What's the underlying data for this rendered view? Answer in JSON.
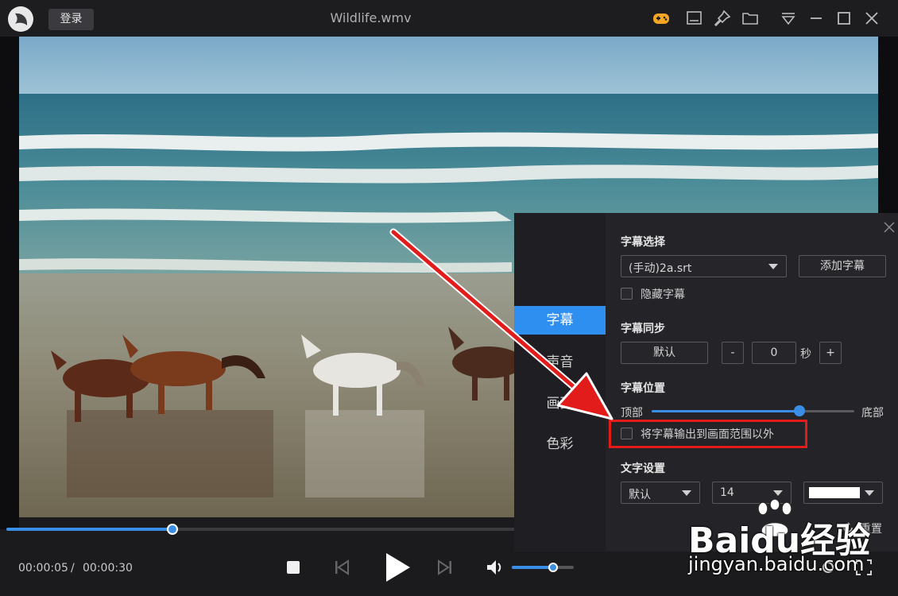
{
  "titlebar": {
    "login_label": "登录",
    "title": "Wildlife.wmv",
    "icons": [
      "game-controller-icon",
      "screenshot-icon",
      "pin-icon",
      "folder-icon",
      "menu-icon",
      "minimize-icon",
      "maximize-icon",
      "close-icon"
    ]
  },
  "player": {
    "progress": 0.188,
    "time_current": "00:00:05",
    "time_separator": "/",
    "time_total": "00:00:30",
    "volume": 0.67
  },
  "panel": {
    "nav": [
      {
        "label": "字幕",
        "active": true
      },
      {
        "label": "声音",
        "active": false
      },
      {
        "label": "画面",
        "active": false
      },
      {
        "label": "色彩",
        "active": false
      }
    ],
    "subtitle_select": {
      "title": "字幕选择",
      "selected": "(手动)2a.srt",
      "add_button": "添加字幕",
      "hide_label": "隐藏字幕"
    },
    "subtitle_sync": {
      "title": "字幕同步",
      "default_button": "默认",
      "minus": "-",
      "value": "0",
      "unit": "秒",
      "plus": "+"
    },
    "subtitle_position": {
      "title": "字幕位置",
      "left_label": "顶部",
      "right_label": "底部",
      "value": 0.73,
      "outside_label": "将字幕输出到画面范围以外"
    },
    "text_settings": {
      "title": "文字设置",
      "font": "默认",
      "size": "14",
      "color": "#ffffff"
    },
    "reset_label": "重置"
  },
  "watermark": {
    "brand": "Baidu经验",
    "url": "jingyan.baidu.com"
  },
  "colors": {
    "accent": "#2f8ff0",
    "highlight": "#e21b1b"
  }
}
